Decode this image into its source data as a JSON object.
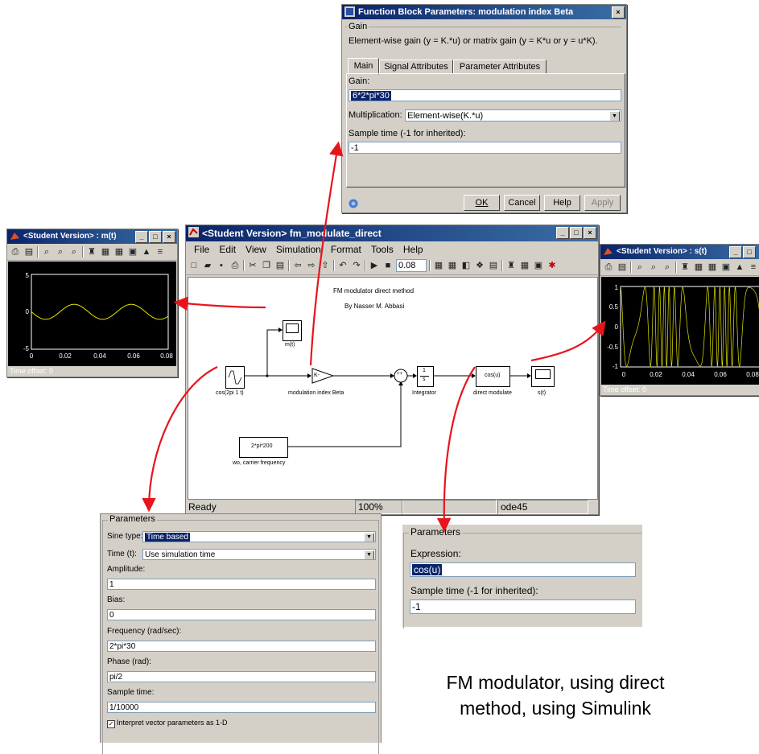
{
  "function_block_dialog": {
    "title": "Function Block Parameters: modulation index Beta",
    "group_label": "Gain",
    "description": "Element-wise gain (y = K.*u) or matrix gain (y = K*u or y = u*K).",
    "tabs": [
      "Main",
      "Signal Attributes",
      "Parameter Attributes"
    ],
    "gain_label": "Gain:",
    "gain_value": "6*2*pi*30",
    "multiplication_label": "Multiplication:",
    "multiplication_value": "Element-wise(K.*u)",
    "sample_time_label": "Sample time (-1 for inherited):",
    "sample_time_value": "-1",
    "buttons": {
      "ok": "OK",
      "cancel": "Cancel",
      "help": "Help",
      "apply": "Apply"
    }
  },
  "scope_m": {
    "title": "<Student Version> : m(t)",
    "y_ticks": [
      "5",
      "0",
      "-5"
    ],
    "x_ticks": [
      "0",
      "0.02",
      "0.04",
      "0.06",
      "0.08"
    ],
    "time_offset_label": "Time offset:",
    "time_offset_value": "0"
  },
  "scope_s": {
    "title": "<Student Version> : s(t)",
    "y_ticks": [
      "1",
      "0.5",
      "0",
      "-0.5",
      "-1"
    ],
    "x_ticks": [
      "0",
      "0.02",
      "0.04",
      "0.06",
      "0.08"
    ],
    "time_offset_label": "Time offset:",
    "time_offset_value": "0"
  },
  "model_window": {
    "title": "<Student Version> fm_modulate_direct",
    "menu": [
      "File",
      "Edit",
      "View",
      "Simulation",
      "Format",
      "Tools",
      "Help"
    ],
    "stop_time": "0.08",
    "diagram_title": "FM modulator direct method",
    "diagram_author": "By Nasser M. Abbasi",
    "blocks": {
      "source": "cos(2pi 1 t)",
      "scope_m_label": "m(t)",
      "gain_label": "modulation index Beta",
      "gain_text": "K-",
      "integrator_num": "1",
      "integrator_den": "s",
      "integrator_label": "Integrator",
      "fcn_text": "cos(u)",
      "fcn_label": "direct modulate",
      "scope_s_label": "s(t)",
      "carrier_text": "2*pi*200",
      "carrier_label": "wo, carrier frequency",
      "sum_signs": "++"
    },
    "status": {
      "ready": "Ready",
      "zoom": "100%",
      "solver": "ode45"
    }
  },
  "sine_params": {
    "group_label": "Parameters",
    "sine_type_label": "Sine type:",
    "sine_type_value": "Time based",
    "time_label": "Time (t):",
    "time_value": "Use simulation time",
    "amplitude_label": "Amplitude:",
    "amplitude_value": "1",
    "bias_label": "Bias:",
    "bias_value": "0",
    "frequency_label": "Frequency (rad/sec):",
    "frequency_value": "2*pi*30",
    "phase_label": "Phase (rad):",
    "phase_value": "pi/2",
    "sample_time_label": "Sample time:",
    "sample_time_value": "1/10000",
    "checkbox_label": "Interpret vector parameters as 1-D"
  },
  "fcn_params": {
    "group_label": "Parameters",
    "expression_label": "Expression:",
    "expression_value": "cos(u)",
    "sample_time_label": "Sample time (-1 for inherited):",
    "sample_time_value": "-1"
  },
  "caption": {
    "line1": "FM modulator, using direct",
    "line2": "method, using Simulink"
  },
  "colors": {
    "arrow": "#e8141c",
    "trace": "#e6e600",
    "titlebar": "#0a246a",
    "dialog": "#d4d0c8"
  }
}
